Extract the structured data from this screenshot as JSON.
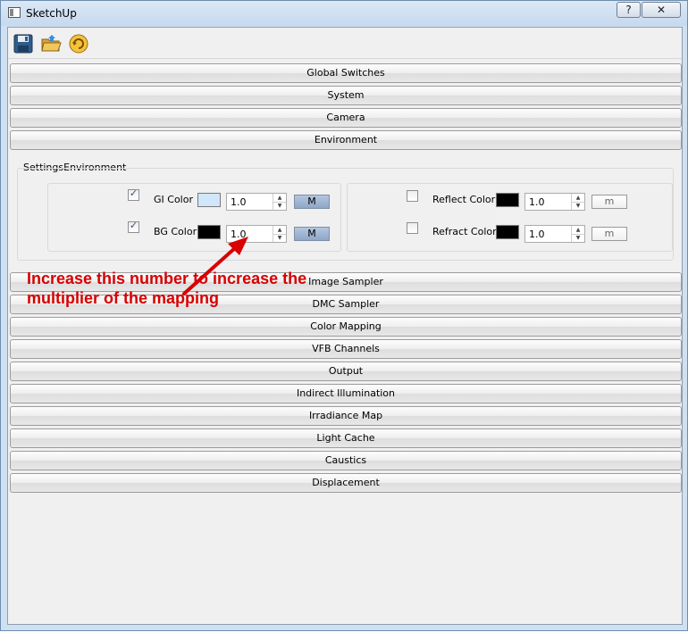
{
  "window": {
    "title": "SketchUp",
    "help_label": "?",
    "close_label": "✕"
  },
  "toolbar": {
    "tools": [
      "save-icon",
      "open-folder-icon",
      "refresh-icon"
    ]
  },
  "panels_top": [
    "Global Switches",
    "System",
    "Camera",
    "Environment"
  ],
  "environment": {
    "group_title": "SettingsEnvironment",
    "left": [
      {
        "label": "GI Color",
        "checked": true,
        "color": "#cfe6fb",
        "value": "1.0",
        "map_label": "M"
      },
      {
        "label": "BG Color",
        "checked": true,
        "color": "#000000",
        "value": "1.0",
        "map_label": "M"
      }
    ],
    "right": [
      {
        "label": "Reflect Color",
        "checked": false,
        "color": "#000000",
        "value": "1.0",
        "map_label": "m"
      },
      {
        "label": "Refract Color",
        "checked": false,
        "color": "#000000",
        "value": "1.0",
        "map_label": "m"
      }
    ]
  },
  "panels_bottom": [
    "Image Sampler",
    "DMC Sampler",
    "Color Mapping",
    "VFB Channels",
    "Output",
    "Indirect Illumination",
    "Irradiance Map",
    "Light Cache",
    "Caustics",
    "Displacement"
  ],
  "annotation": {
    "text": "Increase this number to increase the multiplier of the mapping",
    "color": "#d80000"
  },
  "glyphs": {
    "check": "✓",
    "spin_up": "▲",
    "spin_down": "▼"
  }
}
